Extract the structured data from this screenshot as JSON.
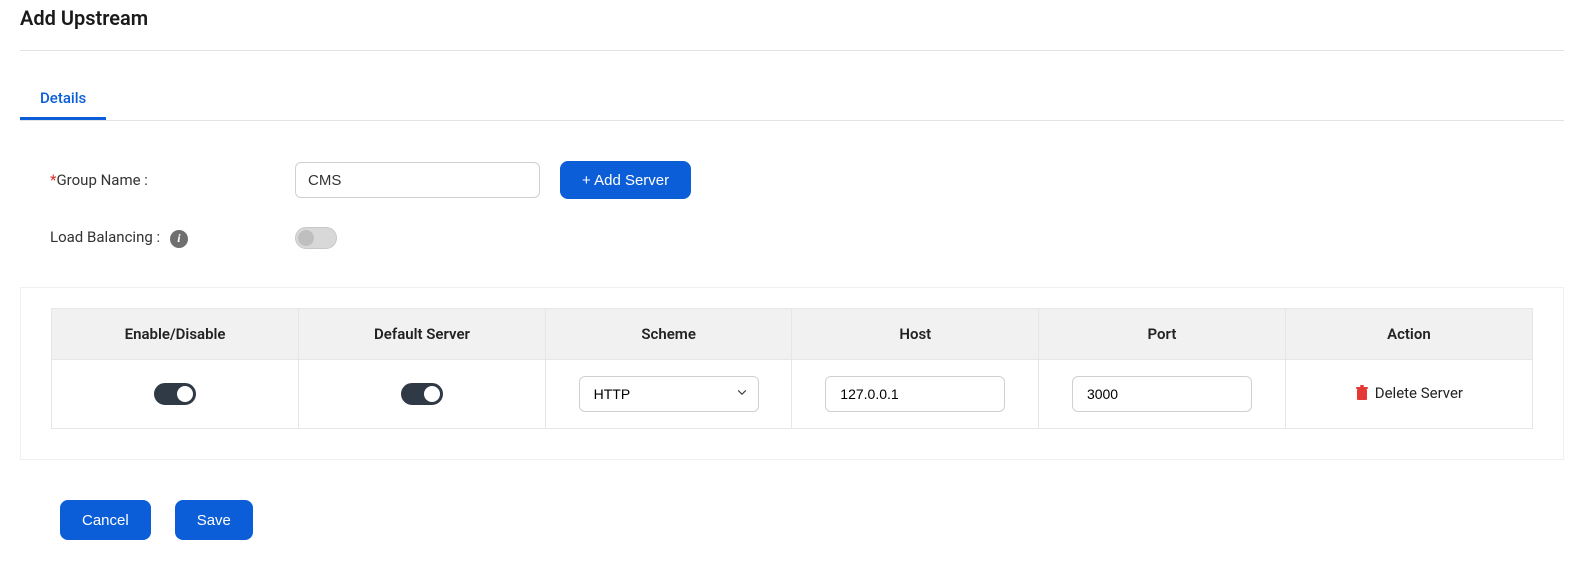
{
  "page_title": "Add Upstream",
  "tabs": {
    "details": "Details"
  },
  "form": {
    "group_name_label": "Group Name :",
    "group_name_value": "CMS",
    "add_server_label": "+ Add Server",
    "load_balancing_label": "Load Balancing :"
  },
  "table": {
    "headers": {
      "enable": "Enable/Disable",
      "default_server": "Default Server",
      "scheme": "Scheme",
      "host": "Host",
      "port": "Port",
      "action": "Action"
    },
    "rows": [
      {
        "enable": true,
        "default_server": true,
        "scheme": "HTTP",
        "host": "127.0.0.1",
        "port": "3000",
        "action_label": "Delete Server"
      }
    ]
  },
  "buttons": {
    "cancel": "Cancel",
    "save": "Save"
  }
}
